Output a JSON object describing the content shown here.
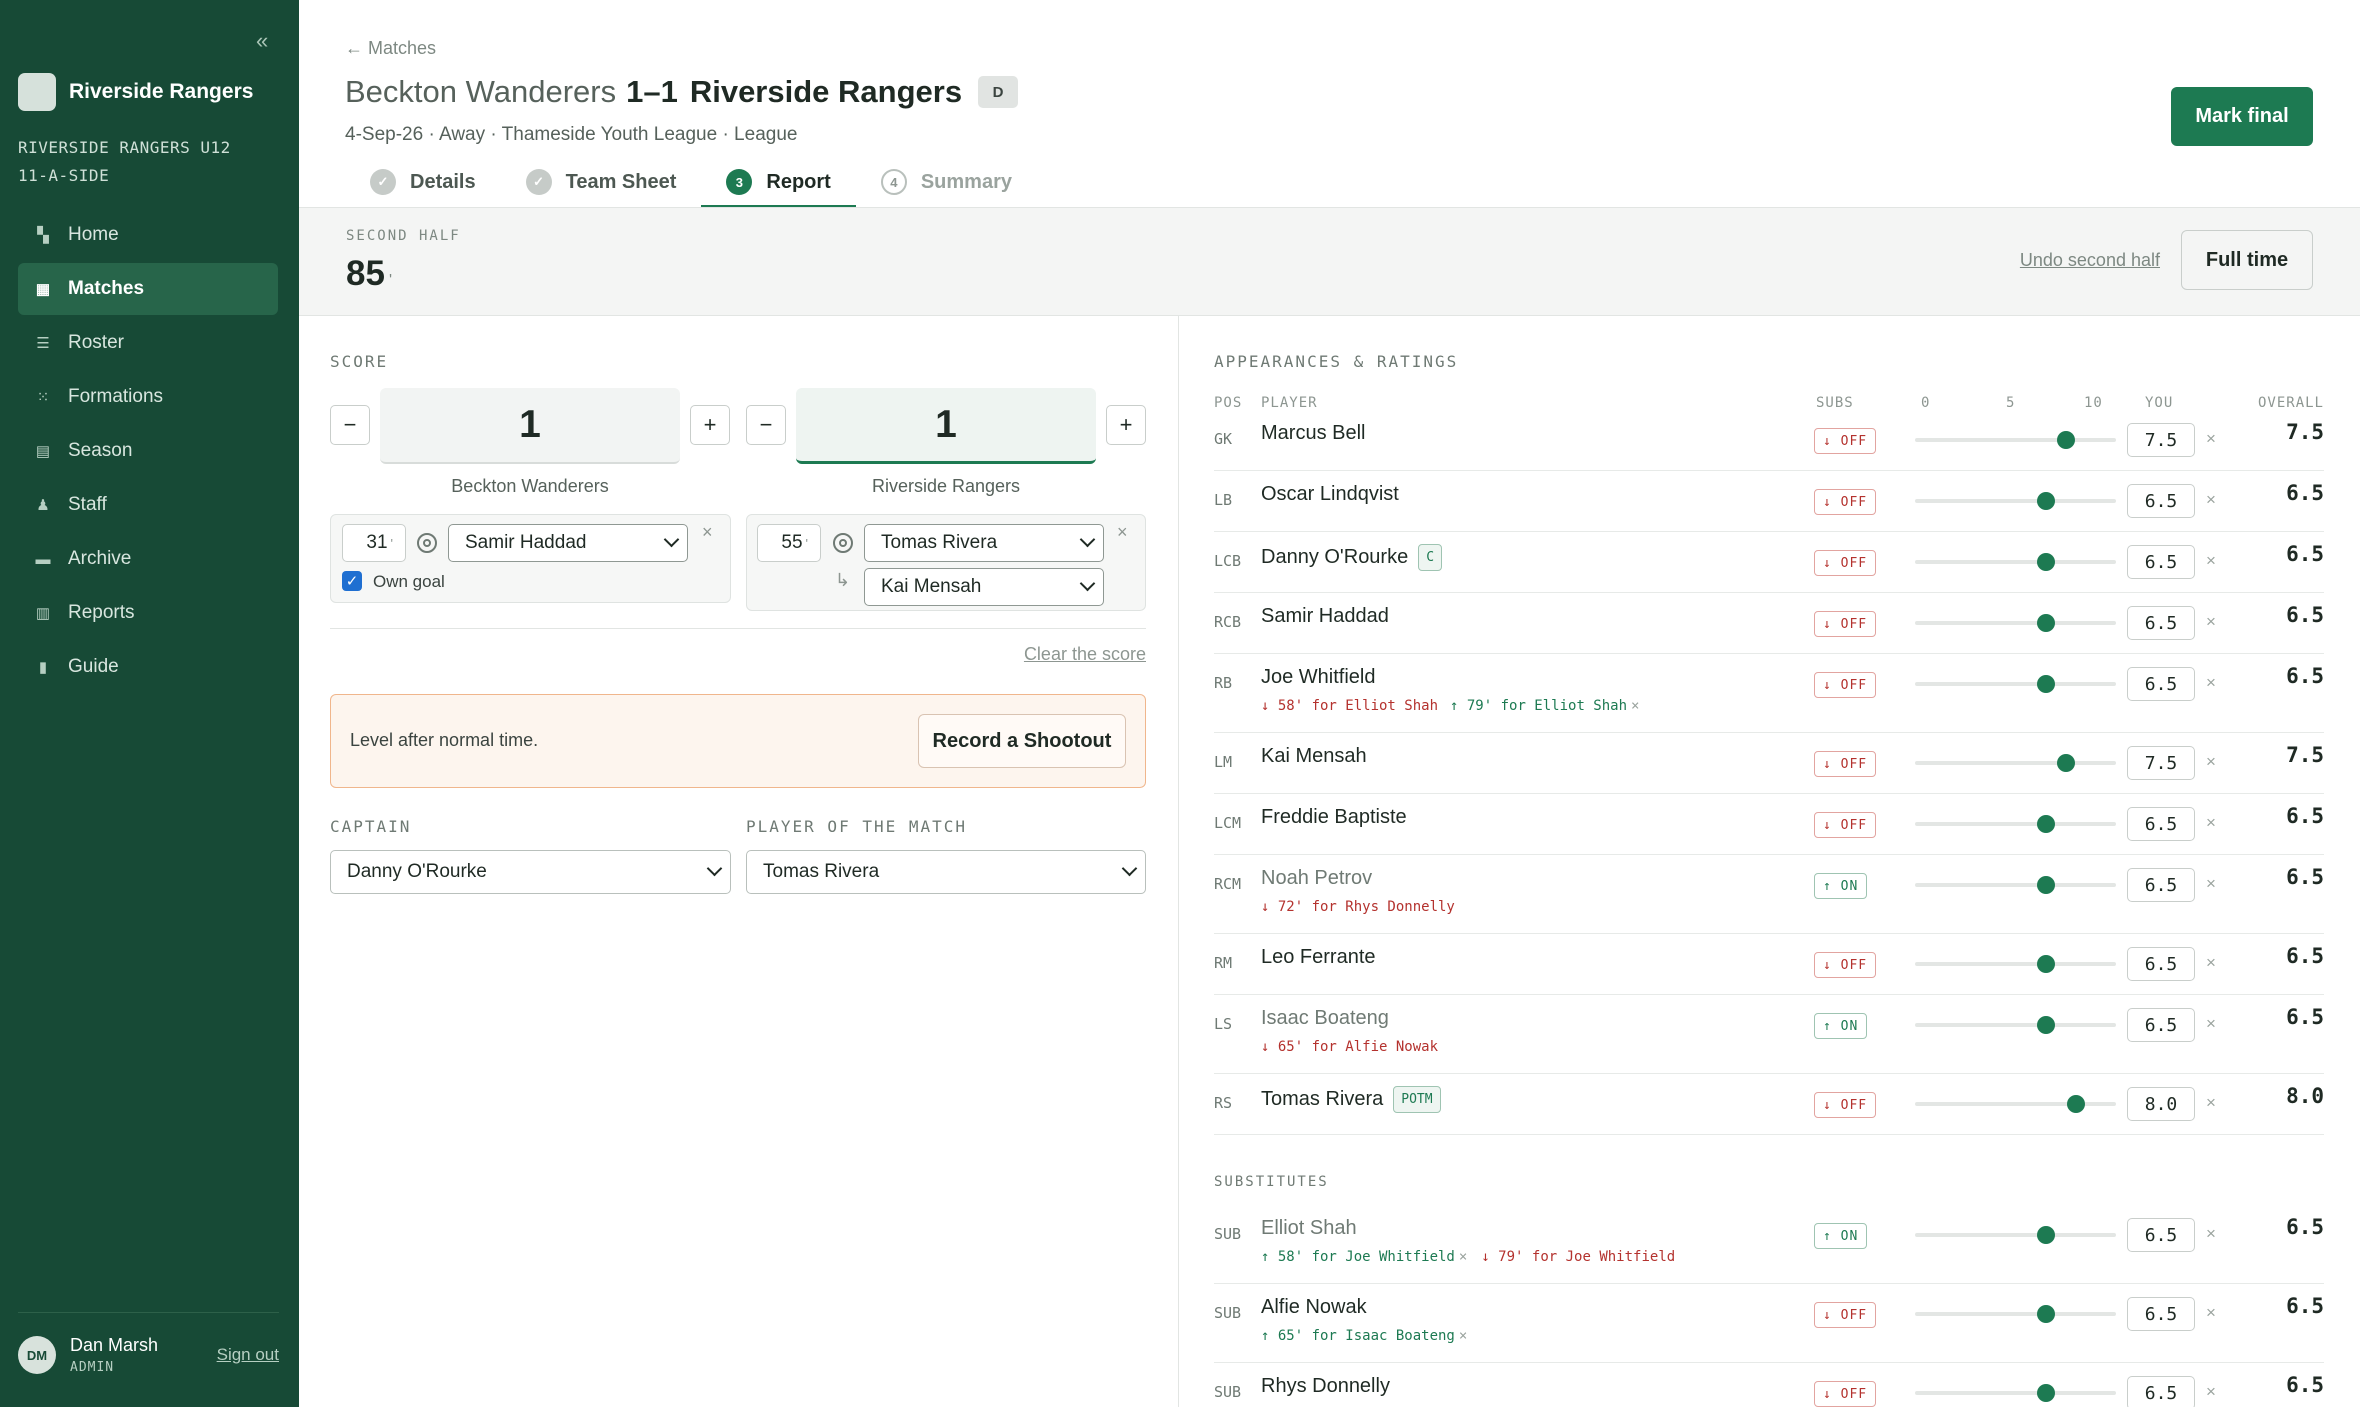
{
  "sidebar": {
    "collapse": "«",
    "brand": "Riverside Rangers",
    "team_line1": "RIVERSIDE RANGERS U12",
    "team_line2": "11-A-SIDE",
    "items": [
      {
        "label": "Home",
        "icon": "home-icon"
      },
      {
        "label": "Matches",
        "icon": "matches-icon",
        "active": true
      },
      {
        "label": "Roster",
        "icon": "roster-icon"
      },
      {
        "label": "Formations",
        "icon": "formations-icon"
      },
      {
        "label": "Season",
        "icon": "calendar-icon"
      },
      {
        "label": "Staff",
        "icon": "staff-icon"
      },
      {
        "label": "Archive",
        "icon": "archive-icon"
      },
      {
        "label": "Reports",
        "icon": "reports-icon"
      },
      {
        "label": "Guide",
        "icon": "guide-icon"
      }
    ],
    "user": {
      "initials": "DM",
      "name": "Dan Marsh",
      "role": "ADMIN",
      "signout": "Sign out"
    }
  },
  "header": {
    "back": "← Matches",
    "home_team": "Beckton Wanderers",
    "score": "1–1",
    "away_team": "Riverside Rangers",
    "result_badge": "D",
    "meta": "4-Sep-26 · Away · Thameside Youth League · League",
    "mark_final": "Mark final",
    "tabs": [
      {
        "label": "Details",
        "marker": "✓",
        "state": "done"
      },
      {
        "label": "Team Sheet",
        "marker": "✓",
        "state": "done"
      },
      {
        "label": "Report",
        "marker": "3",
        "state": "active"
      },
      {
        "label": "Summary",
        "marker": "4",
        "state": "todo"
      }
    ]
  },
  "period": {
    "label": "SECOND HALF",
    "minute": "85",
    "tick": "'",
    "undo": "Undo second half",
    "full_time": "Full time"
  },
  "score": {
    "label": "SCORE",
    "minus": "−",
    "plus": "+",
    "home": {
      "value": "1",
      "team": "Beckton Wanderers"
    },
    "away": {
      "value": "1",
      "team": "Riverside Rangers"
    },
    "home_goal": {
      "minute": "31",
      "tick": "'",
      "scorer": "Samir Haddad",
      "own_goal_label": "Own goal",
      "own_goal": true
    },
    "away_goal": {
      "minute": "55",
      "tick": "'",
      "scorer": "Tomas Rivera",
      "assist": "Kai Mensah"
    },
    "clear": "Clear the score"
  },
  "notice": {
    "text": "Level after normal time.",
    "button": "Record a Shootout"
  },
  "captain": {
    "label": "CAPTAIN",
    "value": "Danny O'Rourke"
  },
  "potm": {
    "label": "PLAYER OF THE MATCH",
    "value": "Tomas Rivera"
  },
  "appearances": {
    "title": "APPEARANCES & RATINGS",
    "columns": {
      "pos": "POS",
      "player": "PLAYER",
      "subs": "SUBS",
      "scale0": "0",
      "scale5": "5",
      "scale10": "10",
      "you": "YOU",
      "overall": "OVERALL"
    },
    "starters": [
      {
        "pos": "GK",
        "name": "Marcus Bell",
        "status": "↓ OFF",
        "you": "7.5",
        "overall": "7.5",
        "rating": 7.5
      },
      {
        "pos": "LB",
        "name": "Oscar Lindqvist",
        "status": "↓ OFF",
        "you": "6.5",
        "overall": "6.5",
        "rating": 6.5
      },
      {
        "pos": "LCB",
        "name": "Danny O'Rourke",
        "tag": "C",
        "status": "↓ OFF",
        "you": "6.5",
        "overall": "6.5",
        "rating": 6.5
      },
      {
        "pos": "RCB",
        "name": "Samir Haddad",
        "status": "↓ OFF",
        "you": "6.5",
        "overall": "6.5",
        "rating": 6.5
      },
      {
        "pos": "RB",
        "name": "Joe Whitfield",
        "status": "↓ OFF",
        "you": "6.5",
        "overall": "6.5",
        "rating": 6.5,
        "events": [
          {
            "text": "↓ 58' for Elliot Shah",
            "kind": "off"
          },
          {
            "text": "↑ 79' for Elliot Shah",
            "kind": "on",
            "x": "×"
          }
        ]
      },
      {
        "pos": "LM",
        "name": "Kai Mensah",
        "status": "↓ OFF",
        "you": "7.5",
        "overall": "7.5",
        "rating": 7.5
      },
      {
        "pos": "LCM",
        "name": "Freddie Baptiste",
        "status": "↓ OFF",
        "you": "6.5",
        "overall": "6.5",
        "rating": 6.5
      },
      {
        "pos": "RCM",
        "name": "Noah Petrov",
        "faded": true,
        "status": "↑ ON",
        "you": "6.5",
        "overall": "6.5",
        "rating": 6.5,
        "events": [
          {
            "text": "↓ 72' for Rhys Donnelly",
            "kind": "off"
          }
        ]
      },
      {
        "pos": "RM",
        "name": "Leo Ferrante",
        "status": "↓ OFF",
        "you": "6.5",
        "overall": "6.5",
        "rating": 6.5
      },
      {
        "pos": "LS",
        "name": "Isaac Boateng",
        "faded": true,
        "status": "↑ ON",
        "you": "6.5",
        "overall": "6.5",
        "rating": 6.5,
        "events": [
          {
            "text": "↓ 65' for Alfie Nowak",
            "kind": "off"
          }
        ]
      },
      {
        "pos": "RS",
        "name": "Tomas Rivera",
        "tag": "POTM",
        "status": "↓ OFF",
        "you": "8.0",
        "overall": "8.0",
        "rating": 8.0
      }
    ],
    "subs_label": "SUBSTITUTES",
    "substitutes": [
      {
        "pos": "SUB",
        "name": "Elliot Shah",
        "faded": true,
        "status": "↑ ON",
        "you": "6.5",
        "overall": "6.5",
        "rating": 6.5,
        "events": [
          {
            "text": "↑ 58' for Joe Whitfield",
            "kind": "on",
            "x": "×"
          },
          {
            "text": "↓ 79' for Joe Whitfield",
            "kind": "off"
          }
        ]
      },
      {
        "pos": "SUB",
        "name": "Alfie Nowak",
        "status": "↓ OFF",
        "you": "6.5",
        "overall": "6.5",
        "rating": 6.5,
        "events": [
          {
            "text": "↑ 65' for Isaac Boateng",
            "kind": "on",
            "x": "×"
          }
        ]
      },
      {
        "pos": "SUB",
        "name": "Rhys Donnelly",
        "status": "↓ OFF",
        "you": "6.5",
        "overall": "6.5",
        "rating": 6.5
      }
    ],
    "remove": "×"
  }
}
